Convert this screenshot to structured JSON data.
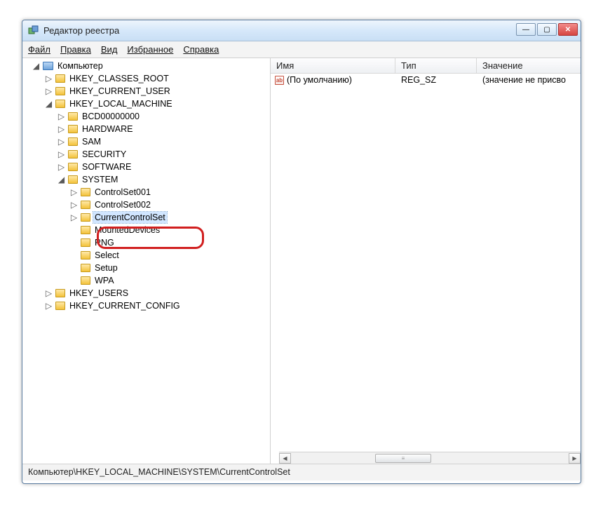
{
  "window": {
    "title": "Редактор реестра"
  },
  "menu": {
    "file": "Файл",
    "edit": "Правка",
    "view": "Вид",
    "favorites": "Избранное",
    "help": "Справка"
  },
  "tree": {
    "root": "Компьютер",
    "hkcr": "HKEY_CLASSES_ROOT",
    "hkcu": "HKEY_CURRENT_USER",
    "hklm": "HKEY_LOCAL_MACHINE",
    "hklm_children": {
      "bcd": "BCD00000000",
      "hardware": "HARDWARE",
      "sam": "SAM",
      "security": "SECURITY",
      "software": "SOFTWARE",
      "system": "SYSTEM"
    },
    "system_children": {
      "cs001": "ControlSet001",
      "cs002": "ControlSet002",
      "ccs": "CurrentControlSet",
      "mounted": "MountedDevices",
      "rng": "RNG",
      "select": "Select",
      "setup": "Setup",
      "wpa": "WPA"
    },
    "hku": "HKEY_USERS",
    "hkcc": "HKEY_CURRENT_CONFIG"
  },
  "list": {
    "header": {
      "name": "Имя",
      "type": "Тип",
      "value": "Значение"
    },
    "row0": {
      "name": "(По умолчанию)",
      "type": "REG_SZ",
      "value": "(значение не присво"
    }
  },
  "statusbar": "Компьютер\\HKEY_LOCAL_MACHINE\\SYSTEM\\CurrentControlSet",
  "glyphs": {
    "expanded": "◢",
    "collapsed": "▷",
    "close": "✕",
    "min": "—",
    "max": "▢",
    "left": "◀",
    "right": "▶",
    "grip": "≡"
  }
}
